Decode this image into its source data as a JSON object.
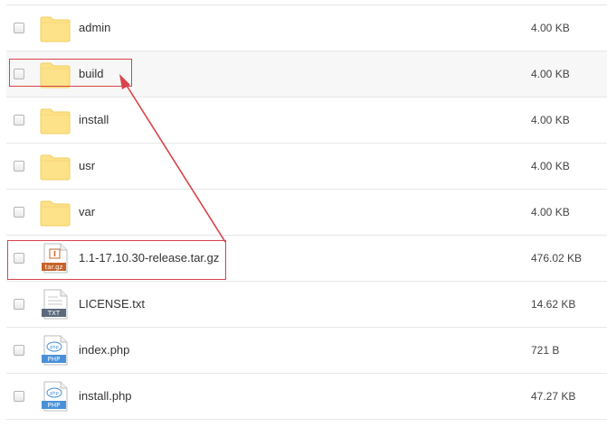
{
  "files": [
    {
      "name": "admin",
      "size": "4.00 KB",
      "icon": "folder-icon"
    },
    {
      "name": "build",
      "size": "4.00 KB",
      "icon": "folder-icon"
    },
    {
      "name": "install",
      "size": "4.00 KB",
      "icon": "folder-icon"
    },
    {
      "name": "usr",
      "size": "4.00 KB",
      "icon": "folder-icon"
    },
    {
      "name": "var",
      "size": "4.00 KB",
      "icon": "folder-icon"
    },
    {
      "name": "1.1-17.10.30-release.tar.gz",
      "size": "476.02 KB",
      "icon": "archive-file-icon",
      "badge": "tar.gz"
    },
    {
      "name": "LICENSE.txt",
      "size": "14.62 KB",
      "icon": "text-file-icon",
      "badge": "TXT"
    },
    {
      "name": "index.php",
      "size": "721 B",
      "icon": "php-file-icon",
      "badge": "PHP"
    },
    {
      "name": "install.php",
      "size": "47.27 KB",
      "icon": "php-file-icon",
      "badge": "PHP"
    }
  ],
  "colors": {
    "folder": "#fde28a",
    "archive_badge": "#c7642a",
    "text_badge": "#5b6a7a",
    "php_badge": "#4a90d9",
    "annotation": "#d9434a"
  }
}
